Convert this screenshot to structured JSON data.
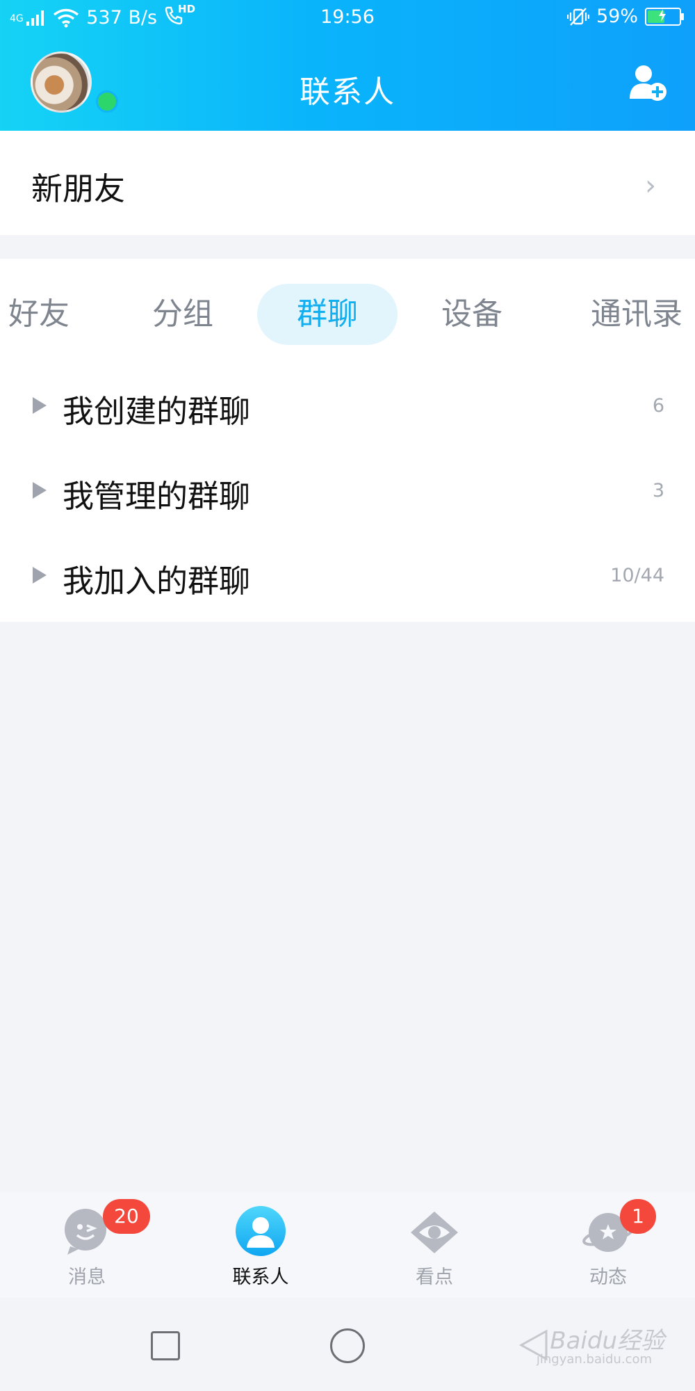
{
  "status_bar": {
    "network": "4G",
    "speed": "537 B/s",
    "hd": "HD",
    "time": "19:56",
    "battery": "59%",
    "battery_level": 0.59
  },
  "header": {
    "title": "联系人"
  },
  "new_friends": {
    "label": "新朋友"
  },
  "tabs": [
    {
      "label": "好友",
      "active": false
    },
    {
      "label": "分组",
      "active": false
    },
    {
      "label": "群聊",
      "active": true
    },
    {
      "label": "设备",
      "active": false
    },
    {
      "label": "通讯录",
      "active": false
    }
  ],
  "groups": [
    {
      "name": "我创建的群聊",
      "count": "6"
    },
    {
      "name": "我管理的群聊",
      "count": "3"
    },
    {
      "name": "我加入的群聊",
      "count": "10/44"
    }
  ],
  "bottom_nav": [
    {
      "label": "消息",
      "badge": "20",
      "icon": "chat-bubble-icon",
      "active": false
    },
    {
      "label": "联系人",
      "badge": "",
      "icon": "contact-person-icon",
      "active": true
    },
    {
      "label": "看点",
      "badge": "",
      "icon": "eye-icon",
      "active": false
    },
    {
      "label": "动态",
      "badge": "1",
      "icon": "planet-star-icon",
      "active": false
    }
  ],
  "watermark": {
    "text": "Baidu经验",
    "sub": "jingyan.baidu.com"
  },
  "colors": {
    "accent": "#11aef0",
    "badge": "#f3483b",
    "online": "#2dd66b"
  }
}
